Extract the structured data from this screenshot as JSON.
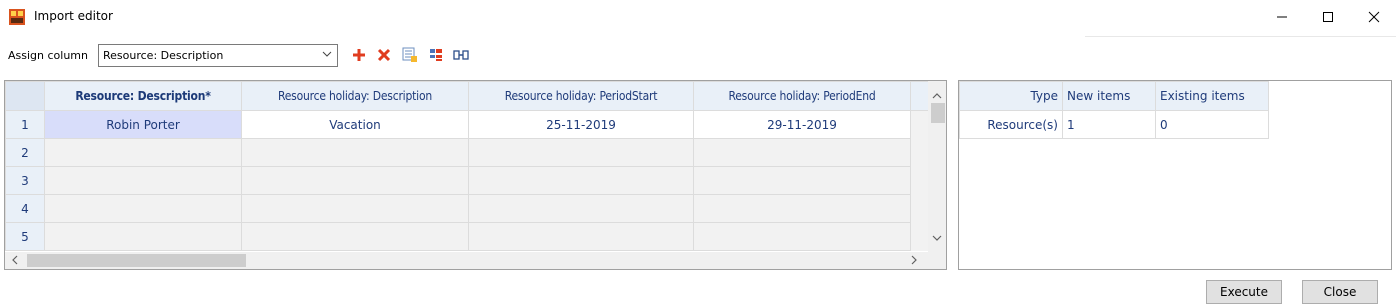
{
  "window": {
    "title": "Import editor",
    "minimize_icon": "minimize-icon",
    "maximize_icon": "maximize-icon",
    "close_icon": "close-icon"
  },
  "toolbar": {
    "assign_label": "Assign column",
    "assign_value": "Resource: Description",
    "icons": [
      "add-icon",
      "delete-icon",
      "edit-list-icon",
      "hierarchy-icon",
      "merge-columns-icon"
    ]
  },
  "grid": {
    "columns": [
      "Resource: Description*",
      "Resource holiday: Description",
      "Resource holiday: PeriodStart",
      "Resource holiday: PeriodEnd"
    ],
    "rows": [
      {
        "num": "1",
        "cells": [
          "Robin Porter",
          "Vacation",
          "25-11-2019",
          "29-11-2019"
        ]
      },
      {
        "num": "2",
        "cells": [
          "",
          "",
          "",
          ""
        ]
      },
      {
        "num": "3",
        "cells": [
          "",
          "",
          "",
          ""
        ]
      },
      {
        "num": "4",
        "cells": [
          "",
          "",
          "",
          ""
        ]
      },
      {
        "num": "5",
        "cells": [
          "",
          "",
          "",
          ""
        ]
      }
    ]
  },
  "summary": {
    "columns": [
      "Type",
      "New items",
      "Existing items"
    ],
    "rows": [
      {
        "type": "Resource(s)",
        "new": "1",
        "existing": "0"
      }
    ]
  },
  "buttons": {
    "execute": "Execute",
    "close": "Close"
  },
  "colors": {
    "header_bg": "#e9f0f8",
    "header_text": "#1f3b7a",
    "selected_cell": "#d8ddfa",
    "add_icon": "#e03c1f",
    "delete_icon": "#e03c1f"
  }
}
